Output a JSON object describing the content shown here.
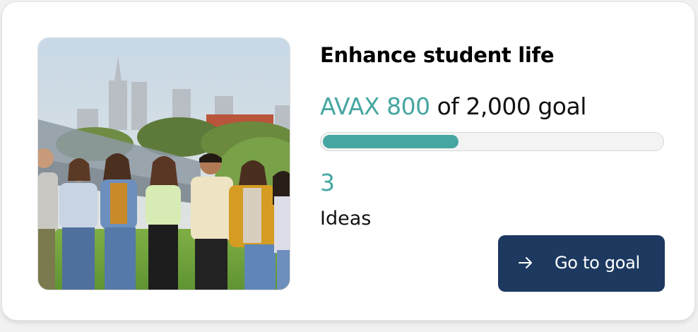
{
  "goal": {
    "title": "Enhance student life",
    "raised": "AVAX 800",
    "goal_text": "of 2,000 goal",
    "progress_fraction": 0.4,
    "ideas_count": "3",
    "ideas_label": "Ideas",
    "button_label": "Go to goal",
    "button_icon": "arrow-right-icon",
    "photo_icon": "group-photo"
  },
  "colors": {
    "accent": "#46a6a1",
    "button": "#1d3960",
    "text": "#111111"
  }
}
